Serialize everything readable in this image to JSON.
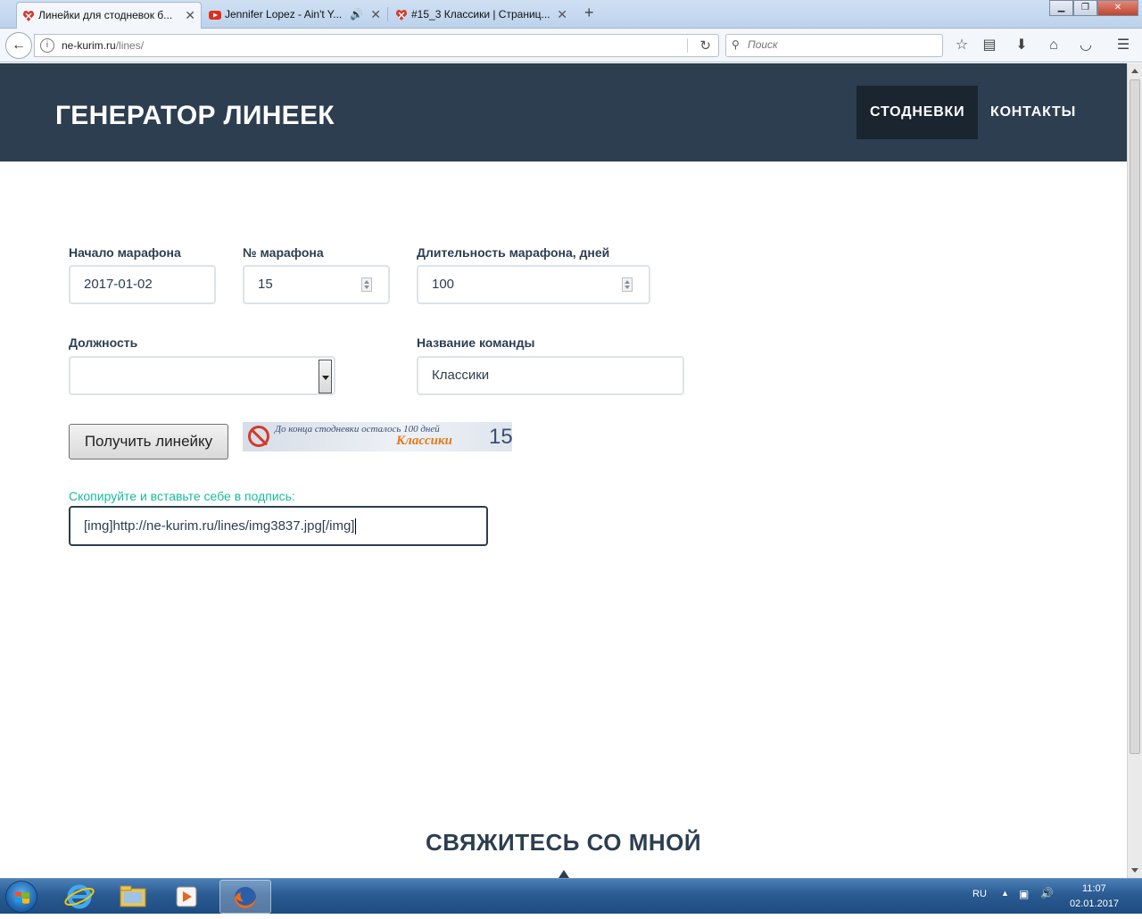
{
  "browser": {
    "tabs": [
      {
        "title": "Линейки для стодневок б..."
      },
      {
        "title": "Jennifer Lopez - Ain't Y..."
      },
      {
        "title": "#15_3 Классики | Страниц..."
      }
    ],
    "new_tab_label": "+",
    "url_domain": "ne-kurim.ru",
    "url_path": "/lines/",
    "search_placeholder": "Поиск"
  },
  "header": {
    "brand": "ГЕНЕРАТОР ЛИНЕЕК",
    "nav": [
      "СТОДНЕВКИ",
      "КОНТАКТЫ"
    ]
  },
  "form": {
    "start_label": "Начало марафона",
    "start_value": "2017-01-02",
    "number_label": "№ марафона",
    "number_value": "15",
    "duration_label": "Длительность марафона, дней",
    "duration_value": "100",
    "position_label": "Должность",
    "position_value": "",
    "team_label": "Название команды",
    "team_value": "Классики",
    "submit_label": "Получить линейку"
  },
  "banner": {
    "text": "До конца стодневки осталось 100 дней",
    "team": "Классики",
    "number": "15"
  },
  "result": {
    "label": "Скопируйте и вставьте себе в подпись:",
    "code": "[img]http://ne-kurim.ru/lines/img3837.jpg[/img]"
  },
  "contact": {
    "title": "СВЯЖИТЕСЬ СО МНОЙ"
  },
  "taskbar": {
    "lang": "RU",
    "time": "11:07",
    "date": "02.01.2017"
  },
  "colors": {
    "header_bg": "#2c3e50",
    "nav_active_bg": "#1a252f",
    "accent_green": "#18bc9c",
    "banner_orange": "#e07b1a"
  }
}
